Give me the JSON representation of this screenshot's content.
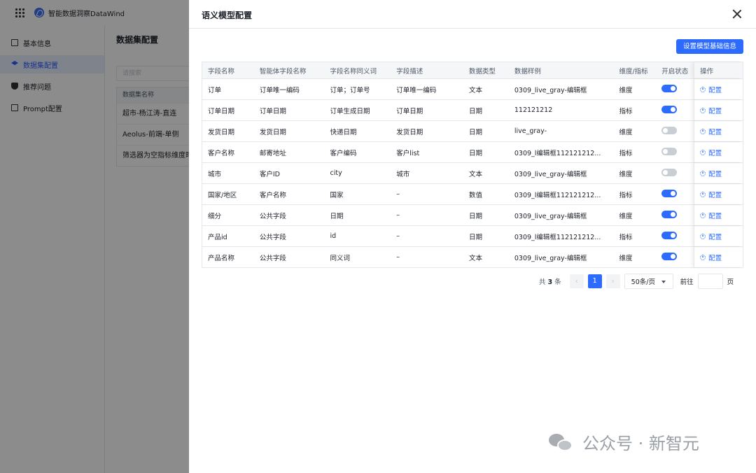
{
  "app": {
    "title": "智能数据洞察DataWind",
    "sidebar": [
      "基本信息",
      "数据集配置",
      "推荐问题",
      "Prompt配置"
    ],
    "main": {
      "title": "数据集配置",
      "search_placeholder": "请搜索",
      "list_header": "数据集名称",
      "list": [
        "超市-杨江涛-直连",
        "Aeolus-前端-单侧",
        "筛选器为空指标维度时"
      ]
    }
  },
  "drawer": {
    "title": "语义模型配置",
    "primary_button": "设置模型基础信息",
    "columns": [
      "字段名称",
      "智能体字段名称",
      "字段名称同义词",
      "字段描述",
      "数据类型",
      "数据样例",
      "维度/指标",
      "开启状态",
      "操作"
    ],
    "rows": [
      {
        "name": "订单",
        "agent_name": "订单唯一编码",
        "synonyms": "订单；订单号",
        "desc": "订单唯一编码",
        "type": "文本",
        "sample": "0309_live_gray-编辑框",
        "kind": "维度",
        "enabled": true,
        "action": "配置"
      },
      {
        "name": "订单日期",
        "agent_name": "订单日期",
        "synonyms": "订单生成日期",
        "desc": "订单日期",
        "type": "日期",
        "sample": "112121212",
        "kind": "指标",
        "enabled": true,
        "action": "配置"
      },
      {
        "name": "发货日期",
        "agent_name": "发货日期",
        "synonyms": "快递日期",
        "desc": "发货日期",
        "type": "日期",
        "sample": "live_gray-",
        "kind": "维度",
        "enabled": false,
        "action": "配置"
      },
      {
        "name": "客户名称",
        "agent_name": "邮寄地址",
        "synonyms": "客户编码",
        "desc": "客户list",
        "type": "日期",
        "sample": "0309_l编辑框112121212...",
        "kind": "指标",
        "enabled": false,
        "action": "配置"
      },
      {
        "name": "城市",
        "agent_name": "客户ID",
        "synonyms": "city",
        "desc": "城市",
        "type": "文本",
        "sample": "0309_live_gray-编辑框",
        "kind": "维度",
        "enabled": false,
        "action": "配置"
      },
      {
        "name": "国家/地区",
        "agent_name": "客户名称",
        "synonyms": "国家",
        "desc": "–",
        "type": "数值",
        "sample": "0309_l编辑框112121212...",
        "kind": "指标",
        "enabled": true,
        "action": "配置"
      },
      {
        "name": "细分",
        "agent_name": "公共字段",
        "synonyms": "日期",
        "desc": "–",
        "type": "日期",
        "sample": "0309_live_gray-编辑框",
        "kind": "维度",
        "enabled": true,
        "action": "配置"
      },
      {
        "name": "产品id",
        "agent_name": "公共字段",
        "synonyms": "id",
        "desc": "–",
        "type": "日期",
        "sample": "0309_l编辑框112121212...",
        "kind": "指标",
        "enabled": true,
        "action": "配置"
      },
      {
        "name": "产品名称",
        "agent_name": "公共字段",
        "synonyms": "同义词",
        "desc": "–",
        "type": "文本",
        "sample": "0309_live_gray-编辑框",
        "kind": "维度",
        "enabled": true,
        "action": "配置"
      }
    ],
    "pagination": {
      "total_prefix": "共",
      "total": "3",
      "total_suffix": "条",
      "current_page": "1",
      "page_size": "50条/页",
      "goto_label": "前往",
      "goto_unit": "页"
    }
  },
  "watermark": {
    "text": "公众号 · 新智元"
  },
  "colors": {
    "primary": "#2d6bff",
    "overlay": "rgba(0,0,0,0.45)",
    "switch_off": "#c9cdd4"
  }
}
